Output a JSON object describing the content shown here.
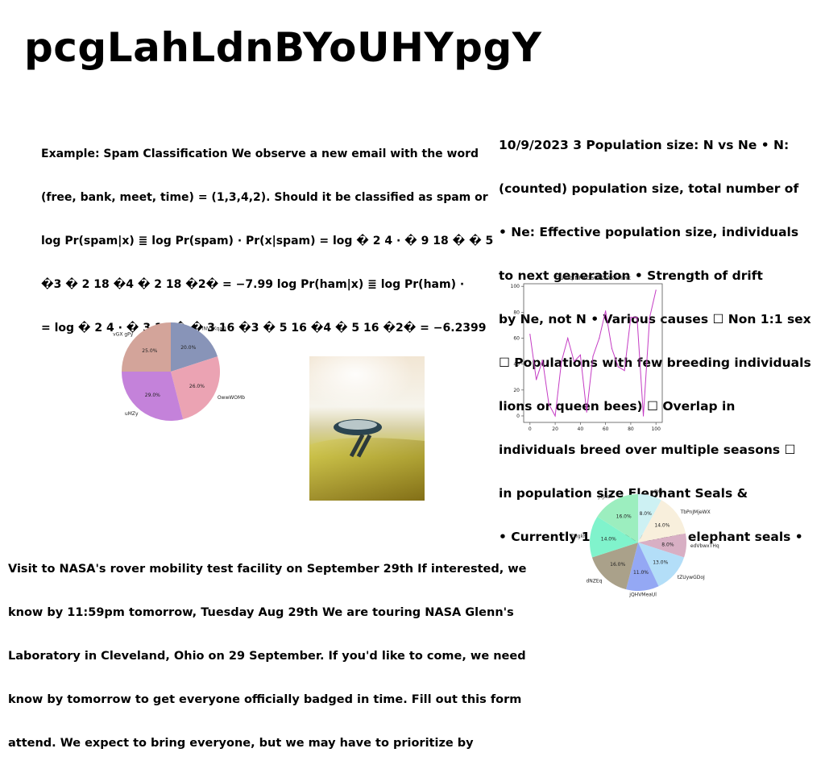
{
  "title": "pcgLahLdnBYoUHYpgY",
  "spam_text": [
    "Example: Spam Classification We observe a new email with the word",
    "(free, bank, meet, time) = (1,3,4,2). Should it be classified as spam or",
    "log Pr(spam|x) ≣ log Pr(spam) · Pr(x|spam) = log � 2 4 · � 9 18 � � 5",
    "�3 � 2 18 �4 � 2 18 �2� = −7.99 log Pr(ham|x) ≣ log Pr(ham) ·",
    "= log � 2 4 · � 3 16 � � 3 16 �3 � 5 16 �4 � 5 16 �2� = −6.2399"
  ],
  "population_text": [
    "10/9/2023 3 Population size: N vs Ne • N:",
    "(counted) population size, total number of",
    "• Ne: Effective population size, individuals",
    "to next generation • Strength of drift",
    "by Ne, not N • Various causes ☐ Non 1:1 sex",
    "☐ Populations with few breeding individuals",
    "lions or queen bees) ☐ Overlap in",
    "individuals breed over multiple seasons ☐",
    "in population size Elephant Seals &",
    "• Currently 150K northern elephant seals •"
  ],
  "nasa_text": [
    "Visit to NASA's rover mobility test facility on September 29th If interested, we",
    "know by 11:59pm tomorrow, Tuesday Aug 29th We are touring NASA Glenn's",
    "Laboratory in Cleveland, Ohio on 29 September. If you'd like to come, we need",
    "know by tomorrow to get everyone officially badged in time. Fill out this form",
    "attend. We expect to bring everyone, but we may have to prioritize by"
  ],
  "chart_data": [
    {
      "type": "pie",
      "title": "",
      "start_angle_deg": 90,
      "direction": "clockwise",
      "slices": [
        {
          "label": "lNVxKqaD",
          "value": 20.0,
          "display": "20.0%",
          "color": "#8894b8"
        },
        {
          "label": "OwwWOMb",
          "value": 26.0,
          "display": "26.0%",
          "color": "#eba3b3"
        },
        {
          "label": "uMZy",
          "value": 29.0,
          "display": "29.0%",
          "color": "#c482da"
        },
        {
          "label": "vGX gPy",
          "value": 25.0,
          "display": "25.0%",
          "color": "#d3a49a"
        }
      ]
    },
    {
      "type": "line",
      "title": "OUWq NFRGaCFZIAKEHmk",
      "color": "#c43cc4",
      "x": [
        0,
        5,
        10,
        15,
        20,
        25,
        30,
        35,
        40,
        45,
        50,
        55,
        60,
        65,
        70,
        75,
        80,
        85,
        90,
        95,
        100
      ],
      "y": [
        63,
        28,
        43,
        9,
        0,
        42,
        60,
        42,
        47,
        3,
        46,
        60,
        81,
        52,
        38,
        35,
        76,
        76,
        0,
        76,
        97
      ],
      "xlim": [
        -5,
        105
      ],
      "ylim": [
        -5,
        102
      ],
      "xticks": [
        0,
        20,
        40,
        60,
        80,
        100
      ],
      "yticks": [
        0,
        20,
        40,
        60,
        80,
        100
      ],
      "grid": false
    },
    {
      "type": "pie",
      "title": "",
      "start_angle_deg": 90,
      "direction": "clockwise",
      "slices": [
        {
          "label": "nfMIj",
          "value": 8.0,
          "display": "8.0%",
          "color": "#cdf1f3"
        },
        {
          "label": "TbPnJMjeWX",
          "value": 14.0,
          "display": "14.0%",
          "color": "#f8efdc"
        },
        {
          "label": "edVbwxTHq",
          "value": 8.0,
          "display": "8.0%",
          "color": "#d8afc4"
        },
        {
          "label": "tZUywGDoJ",
          "value": 13.0,
          "display": "13.0%",
          "color": "#b3def8"
        },
        {
          "label": "jQHVMeaUl",
          "value": 11.0,
          "display": "11.0%",
          "color": "#94a8f4"
        },
        {
          "label": "dNZEq",
          "value": 16.0,
          "display": "16.0%",
          "color": "#aaa18a"
        },
        {
          "label": "ZHgkF",
          "value": 14.0,
          "display": "14.0%",
          "color": "#80f3cc"
        },
        {
          "label": "jTJxdx",
          "value": 16.0,
          "display": "16.0%",
          "color": "#9ceebf"
        }
      ]
    }
  ]
}
